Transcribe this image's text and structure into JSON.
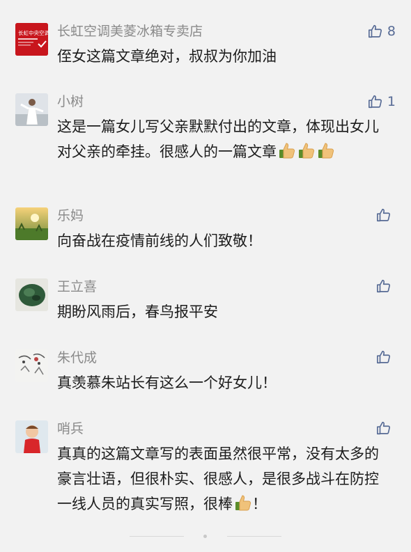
{
  "comments": [
    {
      "name": "长虹空调美菱冰箱专卖店",
      "text": "侄女这篇文章绝对，叔叔为你加油",
      "likes": "8",
      "avatar_text": "长虹中央空调"
    },
    {
      "name": "小树",
      "text": "这是一篇女儿写父亲默默付出的文章，体现出女儿对父亲的牵挂。很感人的一篇文章",
      "likes": "1",
      "emoji_count": 3
    },
    {
      "name": "乐妈",
      "text": "向奋战在疫情前线的人们致敬！",
      "likes": ""
    },
    {
      "name": "王立喜",
      "text": "期盼风雨后，春鸟报平安",
      "likes": ""
    },
    {
      "name": "朱代成",
      "text": "真羡慕朱站长有这么一个好女儿！",
      "likes": ""
    },
    {
      "name": "哨兵",
      "text": "真真的这篇文章写的表面虽然很平常，没有太多的豪言壮语，但很朴实、很感人，是很多战斗在防控一线人员的真实写照，很棒",
      "text_end": "！",
      "likes": "",
      "emoji_count": 1
    }
  ],
  "colors": {
    "like": "#576b95",
    "name": "#8a8a8a",
    "text": "#1c1c1c",
    "background": "#f2f2f2"
  },
  "icons": {
    "like": "thumbs-up-outline-icon",
    "emoji": "thumbs-up-emoji-icon"
  }
}
